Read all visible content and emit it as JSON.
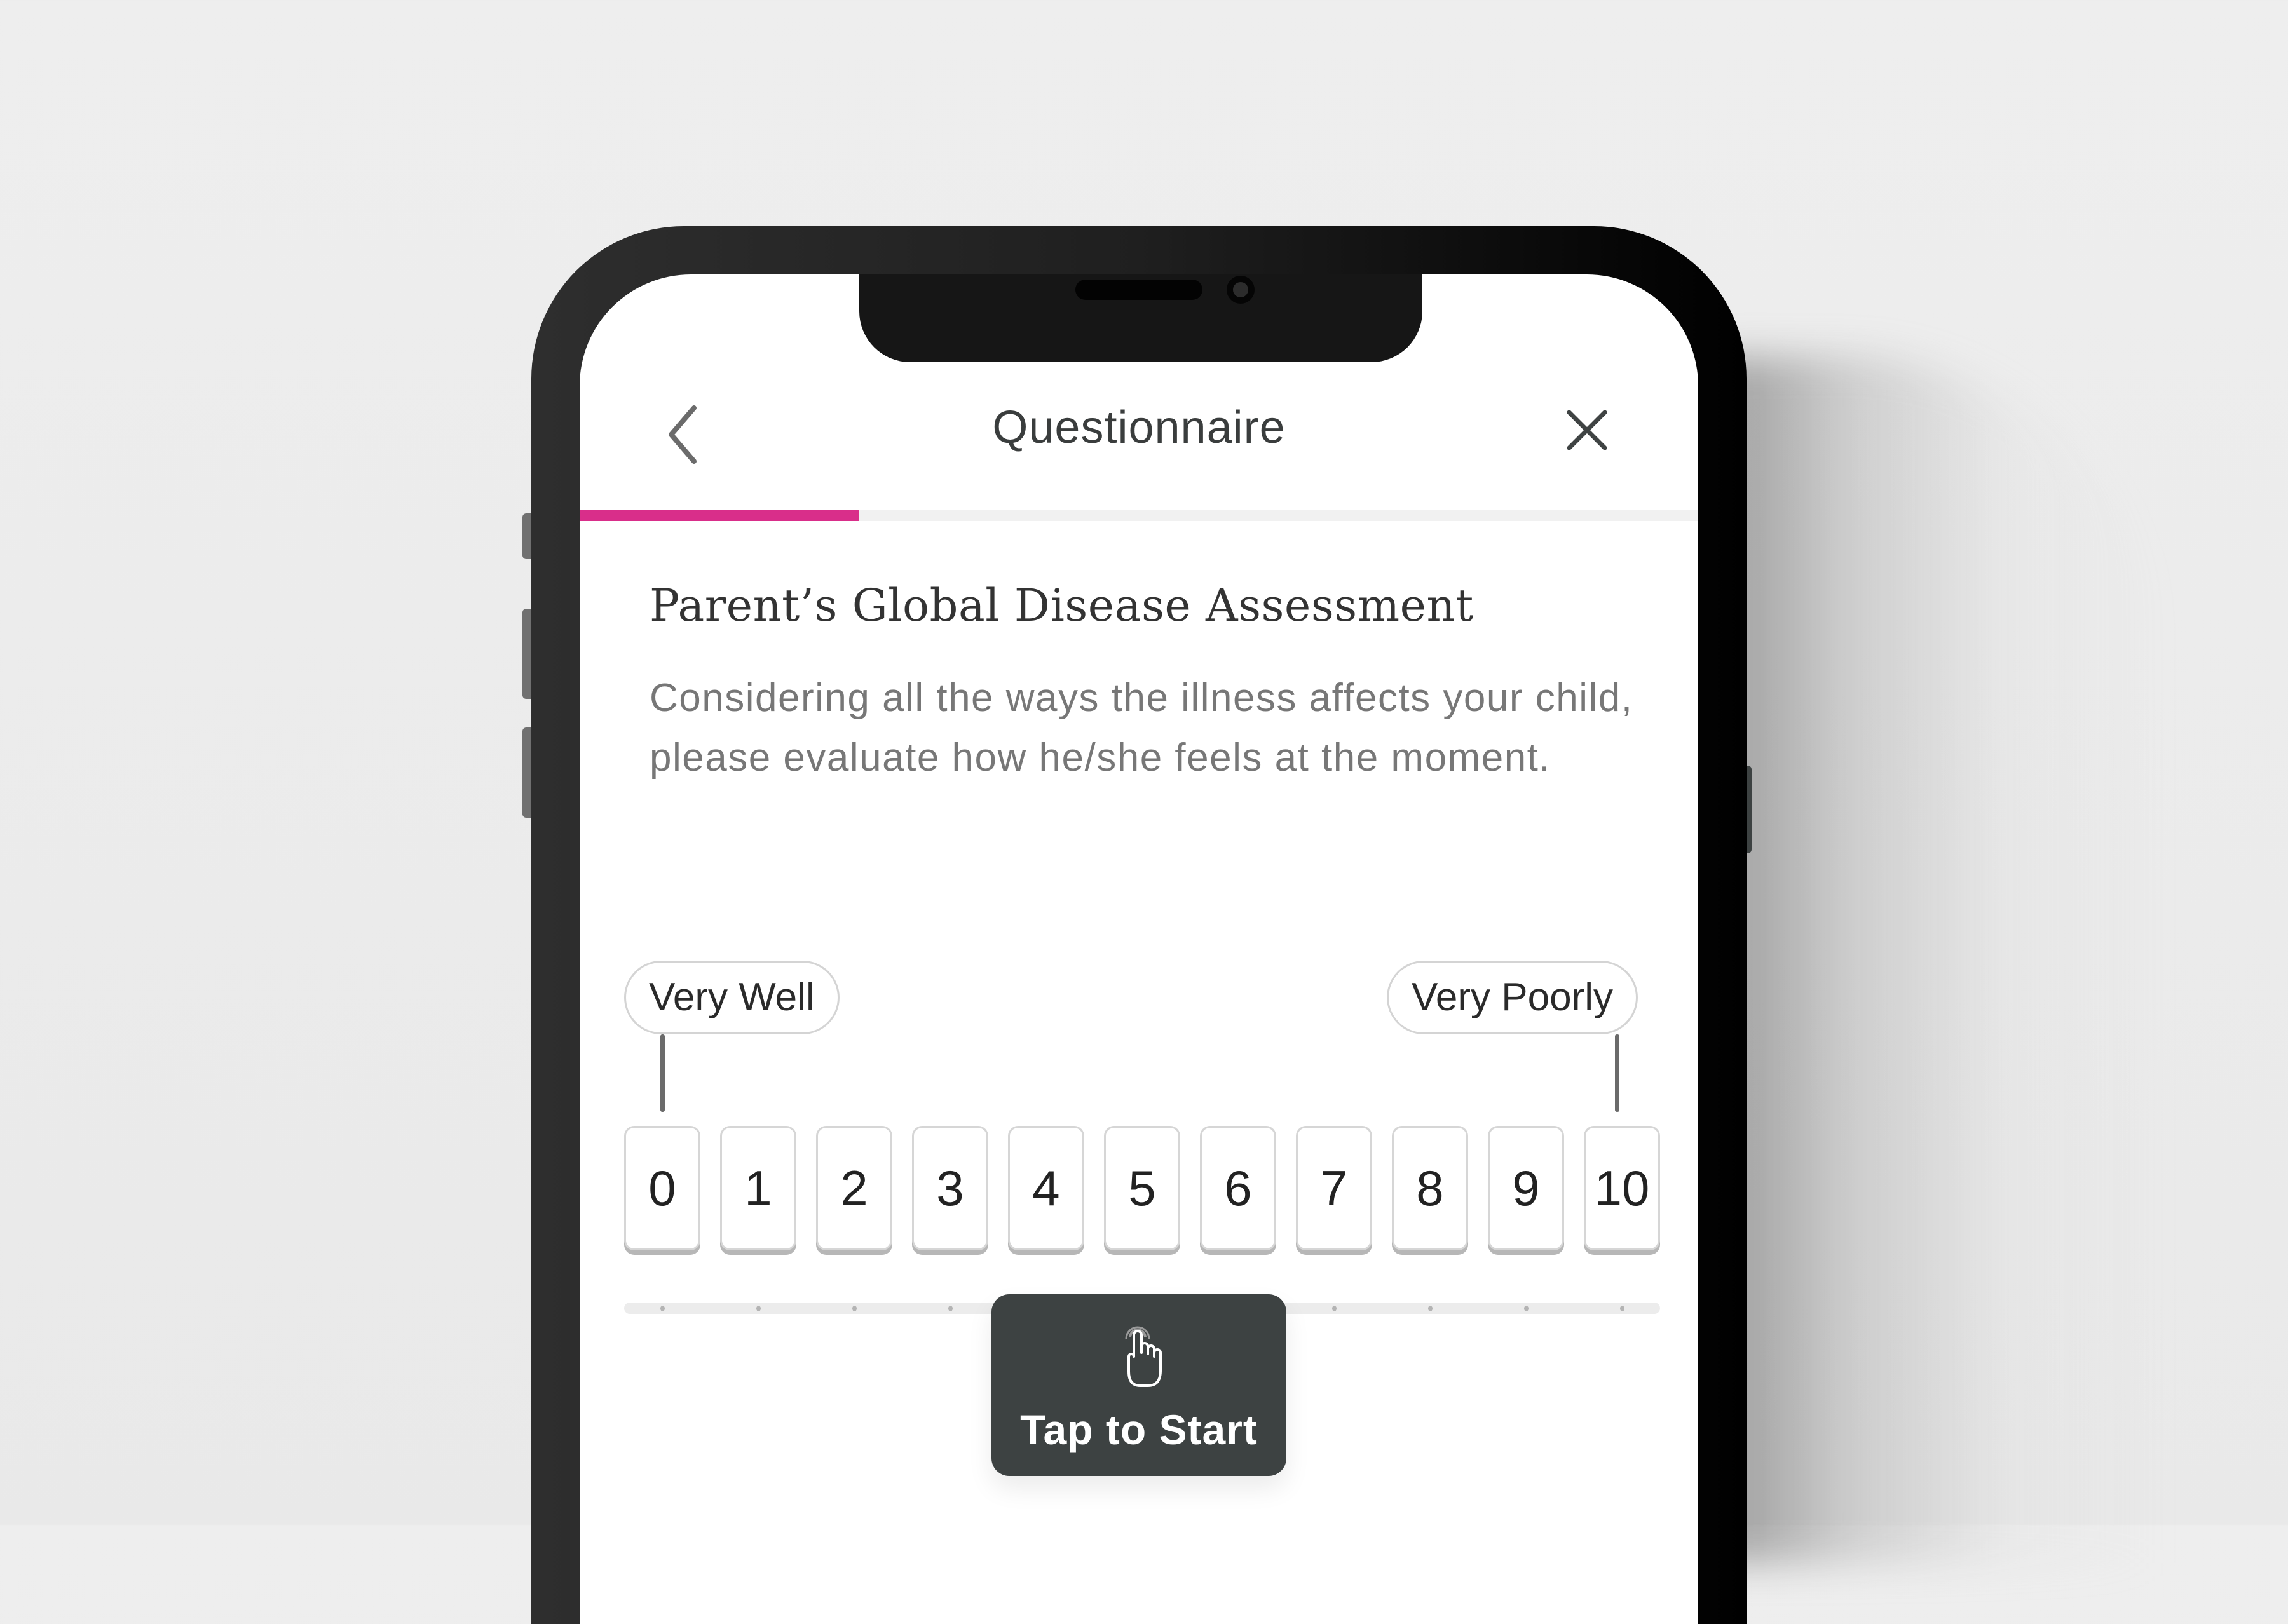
{
  "header": {
    "title": "Questionnaire",
    "back_icon": "chevron-left-icon",
    "close_icon": "close-icon"
  },
  "progress": {
    "fraction": 0.25,
    "color": "#d92e8a"
  },
  "question": {
    "title": "Parent’s Global Disease Assessment",
    "body": "Considering all the ways the illness affects your child, please evaluate how he/she feels at the moment."
  },
  "scale": {
    "min_label": "Very Well",
    "max_label": "Very Poorly",
    "options": [
      "0",
      "1",
      "2",
      "3",
      "4",
      "5",
      "6",
      "7",
      "8",
      "9",
      "10"
    ]
  },
  "tap_button": {
    "label": "Tap to Start",
    "icon": "tap-hand-icon",
    "background": "#3d4242"
  }
}
